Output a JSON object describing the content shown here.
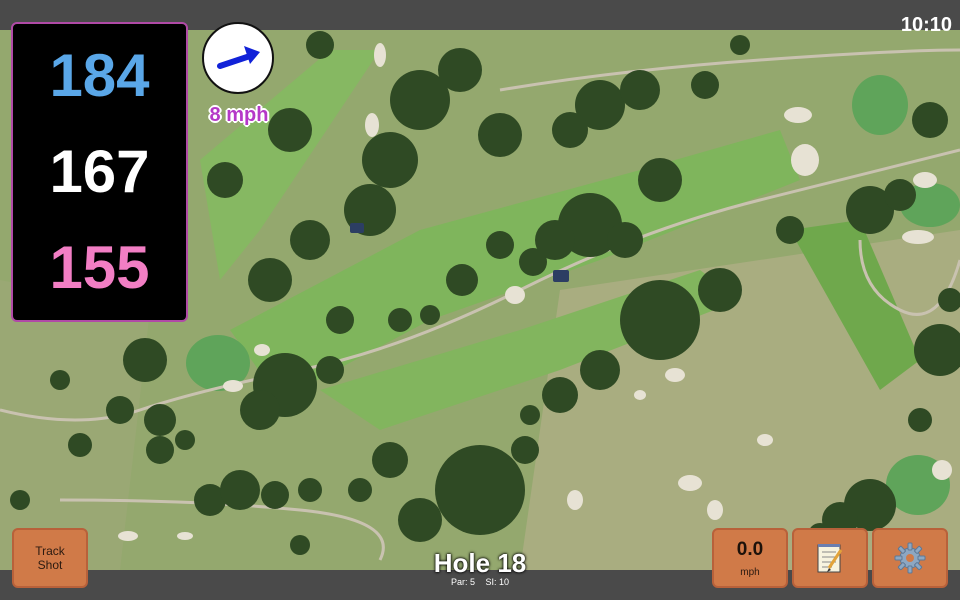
{
  "status": {
    "time": "10:10"
  },
  "distances": {
    "back": "184",
    "center": "167",
    "front": "155"
  },
  "wind": {
    "icon": "wind-arrow-icon",
    "speed_label": "8 mph"
  },
  "buttons": {
    "track_shot_line1": "Track",
    "track_shot_line2": "Shot",
    "speed_value": "0.0",
    "speed_unit": "mph",
    "notes_icon": "notepad-icon",
    "settings_icon": "gear-icon"
  },
  "hole": {
    "title": "Hole 18",
    "par_label": "Par: 5",
    "si_label": "SI: 10"
  },
  "colors": {
    "back_distance": "#5aa7e8",
    "center_distance": "#ffffff",
    "front_distance": "#f27ec4",
    "button_orange": "#d07a48",
    "panel_border": "#b04aa6"
  }
}
